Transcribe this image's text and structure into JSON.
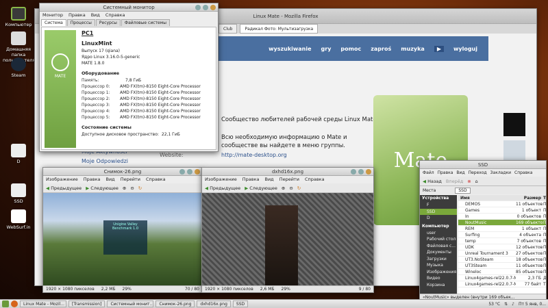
{
  "desktop": {
    "icons": [
      {
        "label": "Компьютер",
        "icon": "computer-icon"
      },
      {
        "label": "Домашняя папка пользователя",
        "icon": "home-folder-icon"
      },
      {
        "label": "Steam",
        "icon": "steam-icon"
      },
      {
        "label": "D",
        "icon": "drive-icon"
      },
      {
        "label": "SSD",
        "icon": "drive-icon"
      },
      {
        "label": "WebSurf.in",
        "icon": "file-icon"
      }
    ]
  },
  "sysmon": {
    "title": "Системный монитор",
    "menu": [
      "Монитор",
      "Правка",
      "Вид",
      "Справка"
    ],
    "tabs": [
      "Система",
      "Процессы",
      "Ресурсы",
      "Файловые системы"
    ],
    "logo_text": "MATE",
    "hostname": "PC1",
    "distro": "LinuxMint",
    "release": "Выпуск 17 (qiana)",
    "kernel": "Ядро Linux 3.16.0-5-generic",
    "mate": "MATE 1.8.0",
    "hw_header": "Оборудование",
    "memory_label": "Память:",
    "memory_value": "7,8 ГиБ",
    "processors": [
      {
        "label": "Процессор 0:",
        "value": "AMD FX(tm)-8150 Eight-Core Processor"
      },
      {
        "label": "Процессор 1:",
        "value": "AMD FX(tm)-8150 Eight-Core Processor"
      },
      {
        "label": "Процессор 2:",
        "value": "AMD FX(tm)-8150 Eight-Core Processor"
      },
      {
        "label": "Процессор 3:",
        "value": "AMD FX(tm)-8150 Eight-Core Processor"
      },
      {
        "label": "Процессор 4:",
        "value": "AMD FX(tm)-8150 Eight-Core Processor"
      },
      {
        "label": "Процессор 5:",
        "value": "AMD FX(tm)-8150 Eight-Core Processor"
      }
    ],
    "status_header": "Состояние системы",
    "disk_label": "Доступное дисковое пространство:",
    "disk_value": "22,1 ГиБ"
  },
  "firefox": {
    "title": "Linux Mate - Mozilla Firefox",
    "tab1": "Club",
    "tab2": "Радикал Фото: Мультизагрузка",
    "nav": [
      "wyszukiwanie",
      "gry",
      "pomoc",
      "zaproś",
      "muzyka",
      "wyloguj"
    ],
    "sidebar_links": [
      "Moje Aktywności",
      "Moje Odpowiedzi"
    ],
    "community_text": "Сообщество любителей рабочей среды Linux Mate",
    "info_text_1": "Всю необходимую информацию о Mate и",
    "info_text_2": "сообществе вы найдете в меню группы.",
    "website_label": "Website:",
    "website_url": "http://mate-desktop.org",
    "mate_logo": "Mate"
  },
  "viewer1": {
    "title": "Снимок-26.png",
    "menu": [
      "Изображение",
      "Правка",
      "Вид",
      "Перейти",
      "Справка"
    ],
    "prev": "Предыдущее",
    "next": "Следующее",
    "status_res": "1920 × 1080 пикселов",
    "status_size": "2,2 МБ",
    "status_zoom": "29%",
    "status_count": "70 / 80",
    "overlay_text": "Unigine Valley Benchmark 1.0"
  },
  "viewer2": {
    "title": "dxhd16x.png",
    "menu": [
      "Изображение",
      "Правка",
      "Вид",
      "Перейти",
      "Справка"
    ],
    "prev": "Предыдущее",
    "next": "Следующее",
    "status_res": "1920 × 1080 пикселов",
    "status_size": "2,6 МБ",
    "status_zoom": "29%",
    "status_count": "9 / 80"
  },
  "caja": {
    "title": "SSD",
    "menu": [
      "Файл",
      "Правка",
      "Вид",
      "Переход",
      "Закладки",
      "Справка"
    ],
    "back": "Назад",
    "forward": "Вперёд",
    "places_label": "Места",
    "path": "SSD",
    "devices_header": "Устройства",
    "devices": [
      "F",
      "SSD",
      "D"
    ],
    "computer_header": "Компьютер",
    "computer_items": [
      "user",
      "Рабочий стол",
      "Файловая с...",
      "Документы",
      "Загрузки",
      "Музыка",
      "Изображения",
      "Видео",
      "Корзина"
    ],
    "col_name": "Имя",
    "col_size": "Размер",
    "col_type": "Тип",
    "files": [
      {
        "name": "DEMOS",
        "size": "11 объектов",
        "type": "Папка"
      },
      {
        "name": "Games",
        "size": "1 объект",
        "type": "Папка"
      },
      {
        "name": "In",
        "size": "0 объектов",
        "type": "Папка"
      },
      {
        "name": "NoutMusic",
        "size": "169 объектов",
        "type": "Папка"
      },
      {
        "name": "REM",
        "size": "1 объект",
        "type": "Папка"
      },
      {
        "name": "Surfing",
        "size": "4 объекта",
        "type": "Папка"
      },
      {
        "name": "temp",
        "size": "7 объектов",
        "type": "Папка"
      },
      {
        "name": "UDK",
        "size": "12 объектов",
        "type": "Папка"
      },
      {
        "name": "Unreal Tournament 3",
        "size": "27 объектов",
        "type": "Папка"
      },
      {
        "name": "UT3.NoSteam",
        "size": "18 объектов",
        "type": "Папка"
      },
      {
        "name": "UT3Steam",
        "size": "11 объектов",
        "type": "Папка"
      },
      {
        "name": "Wineloc",
        "size": "85 объектов",
        "type": "Папка"
      },
      {
        "name": "Linux4games-rel22.0.7-Mi...",
        "size": "2,3 ГБ",
        "type": "Ди"
      },
      {
        "name": "Linux4games-rel22.0.7-Mi...",
        "size": "77 байт",
        "type": "Те"
      }
    ],
    "status": "«NoutMusic» выделен (внутри 169 объек..."
  },
  "taskbar": {
    "tasks": [
      "Linux Mate - Mozil...",
      "[Transmission]",
      "Системный монит...",
      "Снимок-26.png",
      "dxhd16x.png",
      "SSD"
    ],
    "temp": "53 °C",
    "clock": "Пт 5 янв, 0..."
  }
}
